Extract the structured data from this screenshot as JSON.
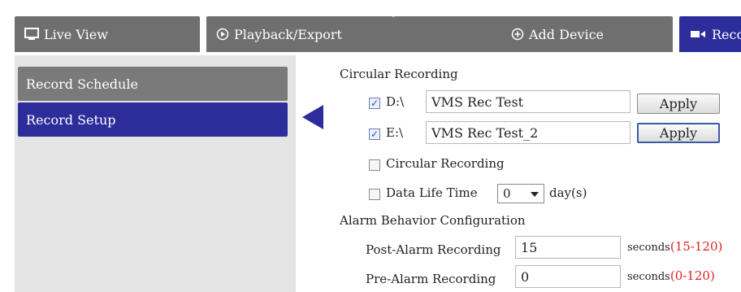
{
  "tabs": {
    "live_view": "Live View",
    "playback": "Playback/Export",
    "add_device": "Add Device",
    "record": "Reco"
  },
  "sidebar": {
    "items": [
      {
        "label": "Record Schedule"
      },
      {
        "label": "Record Setup"
      }
    ]
  },
  "circular": {
    "heading": "Circular Recording",
    "drives": [
      {
        "checked": true,
        "drive": "D:\\",
        "value": "VMS Rec Test",
        "button": "Apply"
      },
      {
        "checked": true,
        "drive": "E:\\",
        "value": "VMS Rec Test_2",
        "button": "Apply"
      }
    ],
    "circular_option": {
      "checked": false,
      "label": "Circular Recording"
    },
    "data_life": {
      "checked": false,
      "label": "Data Life Time",
      "selected": "0",
      "unit": "day(s)"
    }
  },
  "alarm": {
    "heading": "Alarm Behavior Configuration",
    "post": {
      "label": "Post-Alarm Recording",
      "value": "15",
      "unit": "seconds",
      "range": "(15-120)"
    },
    "pre": {
      "label": "Pre-Alarm Recording",
      "value": "0",
      "unit": "seconds",
      "range": "(0-120)"
    }
  },
  "colors": {
    "tab_gray": "#6f6f6f",
    "accent_blue": "#2c2c9a",
    "range_red": "#e02020"
  },
  "icons": {
    "live_view": "monitor-icon",
    "playback": "play-circle-icon",
    "add_device": "plus-circle-icon",
    "record": "camera-icon"
  }
}
